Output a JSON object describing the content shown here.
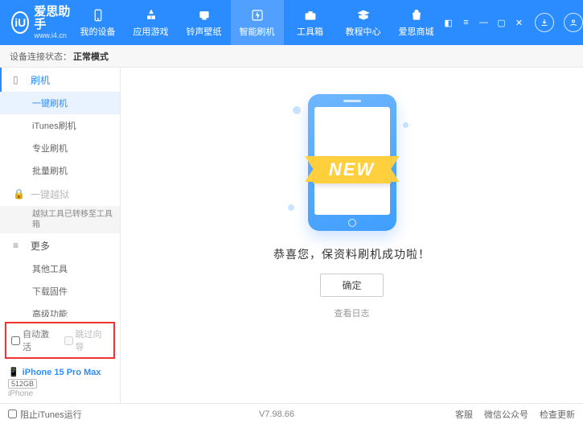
{
  "app": {
    "name_cn": "爱思助手",
    "name_en": "www.i4.cn",
    "logo_letter": "iU"
  },
  "nav": {
    "items": [
      {
        "label": "我的设备",
        "icon": "device"
      },
      {
        "label": "应用游戏",
        "icon": "apps"
      },
      {
        "label": "铃声壁纸",
        "icon": "ringtone"
      },
      {
        "label": "智能刷机",
        "icon": "flash"
      },
      {
        "label": "工具箱",
        "icon": "toolbox"
      },
      {
        "label": "教程中心",
        "icon": "tutorial"
      },
      {
        "label": "爱思商城",
        "icon": "store"
      }
    ],
    "active_index": 3
  },
  "status": {
    "label": "设备连接状态：",
    "value": "正常模式"
  },
  "sidebar": {
    "groups": [
      {
        "icon": "phone-icon",
        "label": "刷机",
        "primary": true,
        "subs": [
          {
            "label": "一键刷机",
            "active": true
          },
          {
            "label": "iTunes刷机"
          },
          {
            "label": "专业刷机"
          },
          {
            "label": "批量刷机"
          }
        ]
      },
      {
        "icon": "lock-icon",
        "label": "一键越狱",
        "locked": true,
        "subs": [
          {
            "label": "越狱工具已转移至工具箱",
            "note": true
          }
        ]
      },
      {
        "icon": "more-icon",
        "label": "更多",
        "subs": [
          {
            "label": "其他工具"
          },
          {
            "label": "下载固件"
          },
          {
            "label": "高级功能"
          }
        ]
      }
    ],
    "checks": {
      "auto_activate": "自动激活",
      "skip_guide": "跳过向导"
    },
    "device": {
      "name": "iPhone 15 Pro Max",
      "capacity": "512GB",
      "type": "iPhone"
    }
  },
  "main": {
    "ribbon": "NEW",
    "success": "恭喜您，保资料刷机成功啦！",
    "ok": "确定",
    "view_log": "查看日志"
  },
  "footer": {
    "block_itunes": "阻止iTunes运行",
    "version": "V7.98.66",
    "links": [
      "客服",
      "微信公众号",
      "检查更新"
    ]
  }
}
